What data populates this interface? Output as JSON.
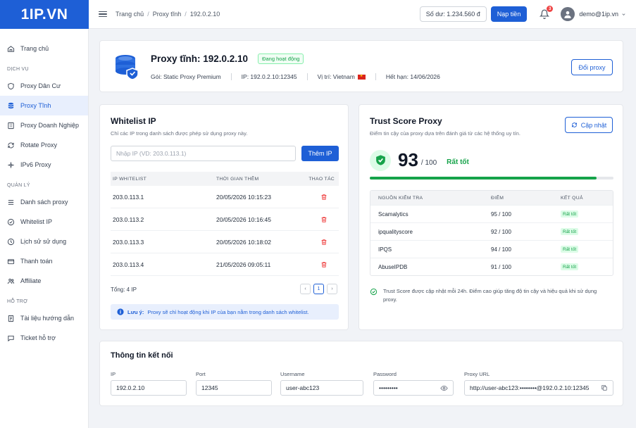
{
  "brand": {
    "logo": "1IP.VN"
  },
  "breadcrumb": [
    "Trang chủ",
    "Proxy tĩnh",
    "192.0.2.10"
  ],
  "topbar": {
    "balance": "Số dư: 1.234.560 đ",
    "topup": "Nạp tiền",
    "notifications": "3",
    "user": "demo@1ip.vn"
  },
  "sidebar": {
    "home": "Trang chủ",
    "sec_services": "DỊCH VỤ",
    "services": [
      "Proxy Dân Cư",
      "Proxy Tĩnh",
      "Proxy Doanh Nghiệp",
      "Rotate Proxy",
      "IPv6 Proxy"
    ],
    "sec_manage": "QUẢN LÝ",
    "manage": [
      "Danh sách proxy",
      "Whitelist IP",
      "Lịch sử sử dụng",
      "Thanh toán",
      "Affiliate"
    ],
    "sec_support": "HỖ TRỢ",
    "support": [
      "Tài liệu hướng dẫn",
      "Ticket hỗ trợ"
    ]
  },
  "header": {
    "title": "Proxy tĩnh: 192.0.2.10",
    "status": "Đang hoạt động",
    "plan": "Gói:  Static Proxy Premium",
    "ip": "IP:  192.0.2.10:12345",
    "location": "Vị trí:  Vietnam",
    "expiry": "Hết hạn:  14/06/2026",
    "change_btn": "Đổi proxy"
  },
  "whitelist": {
    "title": "Whitelist IP",
    "subtitle": "Chỉ các IP trong danh sách được phép sử dụng proxy này.",
    "placeholder": "Nhập IP (VD: 203.0.113.1)",
    "add_btn": "Thêm IP",
    "columns": [
      "IP WHITELIST",
      "THỜI GIAN THÊM",
      "THAO TÁC"
    ],
    "rows": [
      {
        "ip": "203.0.113.1",
        "time": "20/05/2026 10:15:23"
      },
      {
        "ip": "203.0.113.2",
        "time": "20/05/2026 10:16:45"
      },
      {
        "ip": "203.0.113.3",
        "time": "20/05/2026 10:18:02"
      },
      {
        "ip": "203.0.113.4",
        "time": "21/05/2026 09:05:11"
      }
    ],
    "total": "Tổng: 4 IP",
    "page": "1",
    "note_bold": "Lưu ý:",
    "note": "Proxy sẽ chỉ hoạt động khi IP của bạn nằm trong danh sách whitelist."
  },
  "trust": {
    "title": "Trust Score Proxy",
    "subtitle": "Điểm tin cậy của proxy dựa trên đánh giá từ các hệ thống uy tín.",
    "refresh_btn": "Cập nhật",
    "score": "93",
    "max": "/ 100",
    "level": "Rất tốt",
    "progress": 0.93,
    "columns": [
      "NGUỒN KIỂM TRA",
      "ĐIỂM",
      "KẾT QUẢ"
    ],
    "rows": [
      {
        "source": "Scamalytics",
        "score": "95 / 100",
        "result": "Rất tốt"
      },
      {
        "source": "ipqualityscore",
        "score": "92 / 100",
        "result": "Rất tốt"
      },
      {
        "source": "IPQS",
        "score": "94 / 100",
        "result": "Rất tốt"
      },
      {
        "source": "AbuseIPDB",
        "score": "91 / 100",
        "result": "Rất tốt"
      }
    ],
    "footnote": "Trust Score được cập nhật mỗi 24h. Điểm cao giúp tăng độ tin cậy và hiệu quả khi sử dụng proxy."
  },
  "connection": {
    "title": "Thông tin kết nối",
    "ip_label": "IP",
    "ip": "192.0.2.10",
    "port_label": "Port",
    "port": "12345",
    "user_label": "Username",
    "user": "user-abc123",
    "pass_label": "Password",
    "pass": "•••••••••",
    "url_label": "Proxy URL",
    "url": "http://user-abc123:••••••••@192.0.2.10:12345"
  },
  "colors": {
    "brand": "#1e5fd6",
    "success": "#16a34a",
    "danger": "#ef4444"
  }
}
